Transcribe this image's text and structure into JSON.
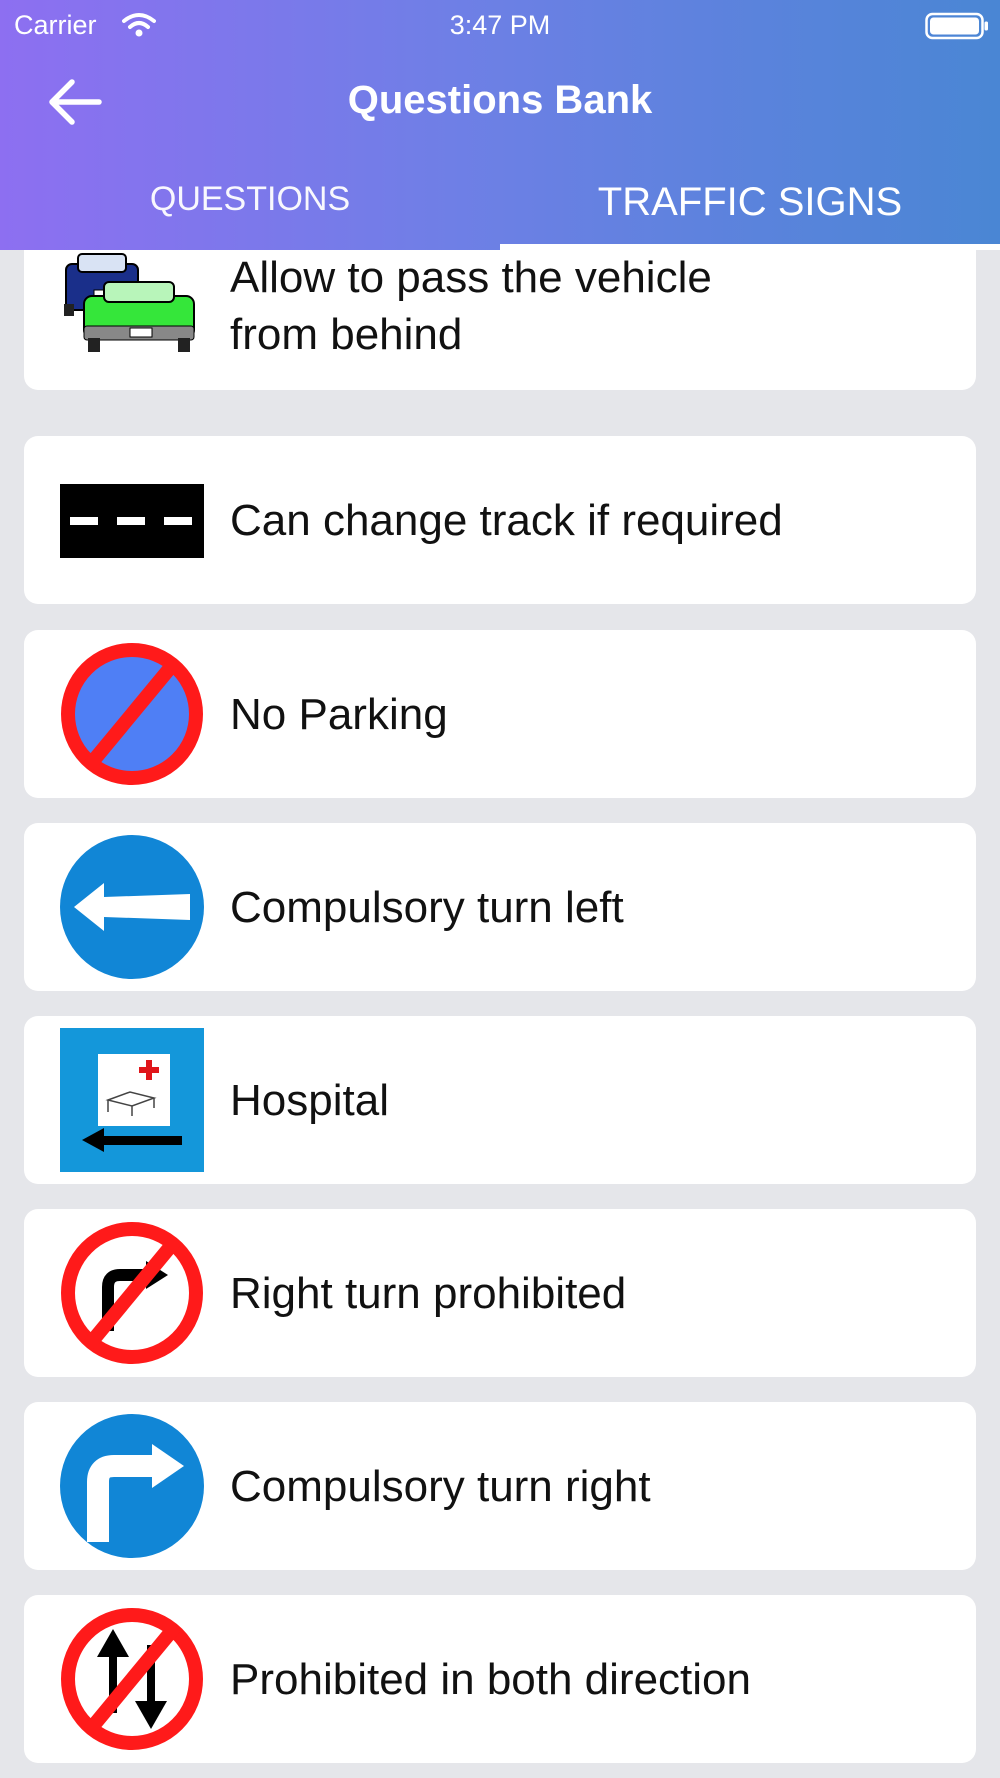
{
  "status_bar": {
    "carrier": "Carrier",
    "time": "3:47 PM"
  },
  "header": {
    "title": "Questions Bank",
    "back_icon": "arrow-left-icon"
  },
  "tabs": [
    {
      "label": "QUESTIONS",
      "selected": false
    },
    {
      "label": "TRAFFIC SIGNS",
      "selected": true
    }
  ],
  "colors": {
    "header_gradient_start": "#8d6ff1",
    "header_gradient_end": "#4a86d4",
    "sign_red": "#ff1a1a",
    "sign_blue": "#1186d6",
    "no_parking_blue": "#4f7ff5",
    "background": "#e5e6ea"
  },
  "signs": [
    {
      "icon": "overtaking-cars-icon",
      "label": "Allow to pass the vehicle\nfrom behind"
    },
    {
      "icon": "broken-lane-line-icon",
      "label": "Can change track if required"
    },
    {
      "icon": "no-parking-sign-icon",
      "label": "No Parking"
    },
    {
      "icon": "compulsory-left-sign-icon",
      "label": "Compulsory turn left"
    },
    {
      "icon": "hospital-sign-icon",
      "label": "Hospital"
    },
    {
      "icon": "no-right-turn-sign-icon",
      "label": "Right turn prohibited"
    },
    {
      "icon": "compulsory-right-sign-icon",
      "label": "Compulsory turn right"
    },
    {
      "icon": "no-entry-both-directions-sign-icon",
      "label": "Prohibited in both direction"
    }
  ]
}
